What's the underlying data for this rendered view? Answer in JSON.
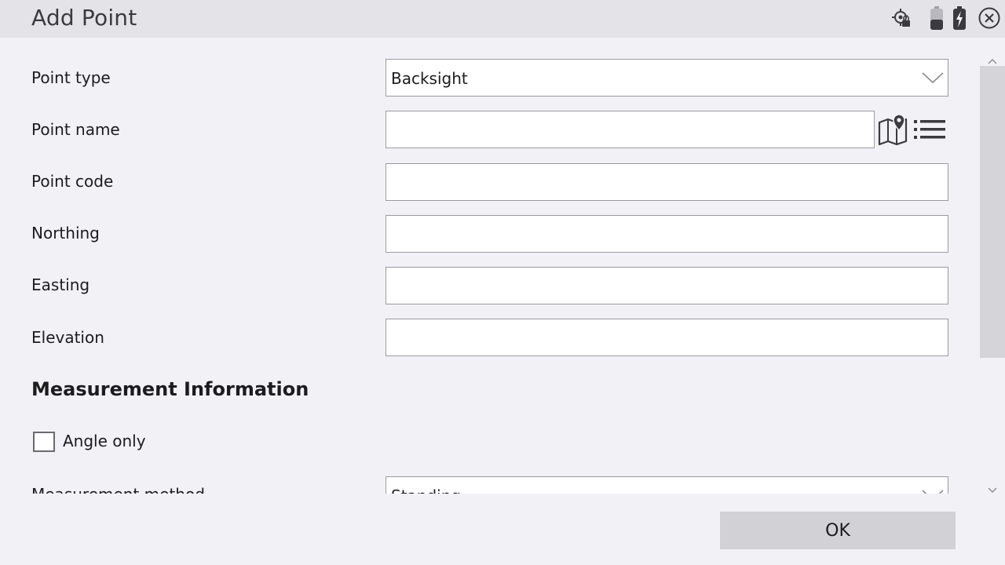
{
  "window": {
    "title": "Add Point"
  },
  "status_icons": [
    "gps-locked-icon",
    "battery-low-icon",
    "battery-charging-icon",
    "close-icon"
  ],
  "form": {
    "point_type": {
      "label": "Point type",
      "value": "Backsight"
    },
    "point_name": {
      "label": "Point name",
      "value": ""
    },
    "point_code": {
      "label": "Point code",
      "value": ""
    },
    "northing": {
      "label": "Northing",
      "value": ""
    },
    "easting": {
      "label": "Easting",
      "value": ""
    },
    "elevation": {
      "label": "Elevation",
      "value": ""
    }
  },
  "measurement": {
    "heading": "Measurement Information",
    "angle_only": {
      "label": "Angle only",
      "checked": false
    },
    "method": {
      "label": "Measurement method",
      "value": "Standing"
    }
  },
  "footer": {
    "ok_label": "OK"
  },
  "colors": {
    "titlebar": "#e3e3e8",
    "background": "#f2f2f6",
    "button": "#d1d1d6",
    "scroll_thumb": "#d4d4d9"
  }
}
